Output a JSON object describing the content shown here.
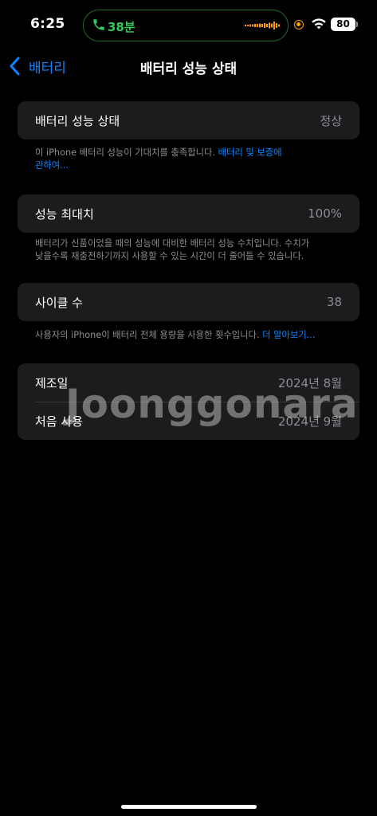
{
  "status_bar": {
    "time": "6:25",
    "call_duration": "38분",
    "battery_level": "80"
  },
  "nav": {
    "back_label": "배터리",
    "title": "배터리 성능 상태"
  },
  "battery_health": {
    "label": "배터리 성능 상태",
    "value": "정상",
    "footer_text": "이 iPhone 배터리 성능이 기대치를 충족합니다. ",
    "footer_link_line1": "배터리 및 보증에",
    "footer_link_line2": "관하여..."
  },
  "max_capacity": {
    "label": "성능 최대치",
    "value": "100%",
    "footer_line1": "배터리가 신품이었을 때의 성능에 대비한 배터리 성능 수치입니다. 수치가",
    "footer_line2": "낮을수록 재충전하기까지 사용할 수 있는 시간이 더 줄어들 수 있습니다."
  },
  "cycle_count": {
    "label": "사이클 수",
    "value": "38",
    "footer_text": "사용자의 iPhone이 배터리 전체 용량을 사용한 횟수입니다. ",
    "footer_link": "더 알아보기..."
  },
  "dates": {
    "manufacture_label": "제조일",
    "manufacture_value": "2024년 8월",
    "first_use_label": "처음 사용",
    "first_use_value": "2024년 9월"
  },
  "watermark": "Joonggonara",
  "colors": {
    "accent": "#0a84ff",
    "call_green": "#34c759",
    "mic_orange": "#ff9f0a",
    "cell_bg": "#1c1c1e"
  }
}
